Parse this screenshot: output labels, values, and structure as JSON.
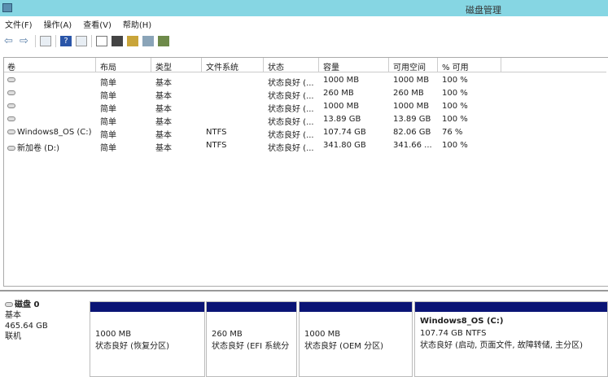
{
  "window": {
    "title": "磁盘管理"
  },
  "menu": [
    "文件(F)",
    "操作(A)",
    "查看(V)",
    "帮助(H)"
  ],
  "toolbar": [
    "back-icon",
    "forward-icon",
    "console-tree-icon",
    "help-icon",
    "properties-icon",
    "refresh-icon",
    "settings-icon",
    "open-icon",
    "search-icon",
    "map-icon"
  ],
  "columns": [
    "卷",
    "布局",
    "类型",
    "文件系统",
    "状态",
    "容量",
    "可用空间",
    "% 可用"
  ],
  "rows": [
    {
      "vol": "",
      "layout": "简单",
      "type": "基本",
      "fs": "",
      "status": "状态良好 (...",
      "cap": "1000 MB",
      "free": "1000 MB",
      "pct": "100 %"
    },
    {
      "vol": "",
      "layout": "简单",
      "type": "基本",
      "fs": "",
      "status": "状态良好 (...",
      "cap": "260 MB",
      "free": "260 MB",
      "pct": "100 %"
    },
    {
      "vol": "",
      "layout": "简单",
      "type": "基本",
      "fs": "",
      "status": "状态良好 (...",
      "cap": "1000 MB",
      "free": "1000 MB",
      "pct": "100 %"
    },
    {
      "vol": "",
      "layout": "简单",
      "type": "基本",
      "fs": "",
      "status": "状态良好 (...",
      "cap": "13.89 GB",
      "free": "13.89 GB",
      "pct": "100 %"
    },
    {
      "vol": "Windows8_OS (C:)",
      "layout": "简单",
      "type": "基本",
      "fs": "NTFS",
      "status": "状态良好 (...",
      "cap": "107.74 GB",
      "free": "82.06 GB",
      "pct": "76 %"
    },
    {
      "vol": "新加卷 (D:)",
      "layout": "简单",
      "type": "基本",
      "fs": "NTFS",
      "status": "状态良好 (...",
      "cap": "341.80 GB",
      "free": "341.66 ...",
      "pct": "100 %"
    }
  ],
  "disk": {
    "name": "磁盘 0",
    "type": "基本",
    "size": "465.64 GB",
    "state": "联机"
  },
  "partitions": [
    {
      "title": "",
      "size": "1000 MB",
      "status": "状态良好 (恢复分区)"
    },
    {
      "title": "",
      "size": "260 MB",
      "status": "状态良好 (EFI 系统分"
    },
    {
      "title": "",
      "size": "1000 MB",
      "status": "状态良好 (OEM 分区)"
    },
    {
      "title": "Windows8_OS  (C:)",
      "size": "107.74 GB NTFS",
      "status": "状态良好 (启动, 页面文件, 故障转储, 主分区)"
    }
  ],
  "colors": {
    "titlebar": "#86d6e3",
    "partition_bar": "#0a1475"
  }
}
